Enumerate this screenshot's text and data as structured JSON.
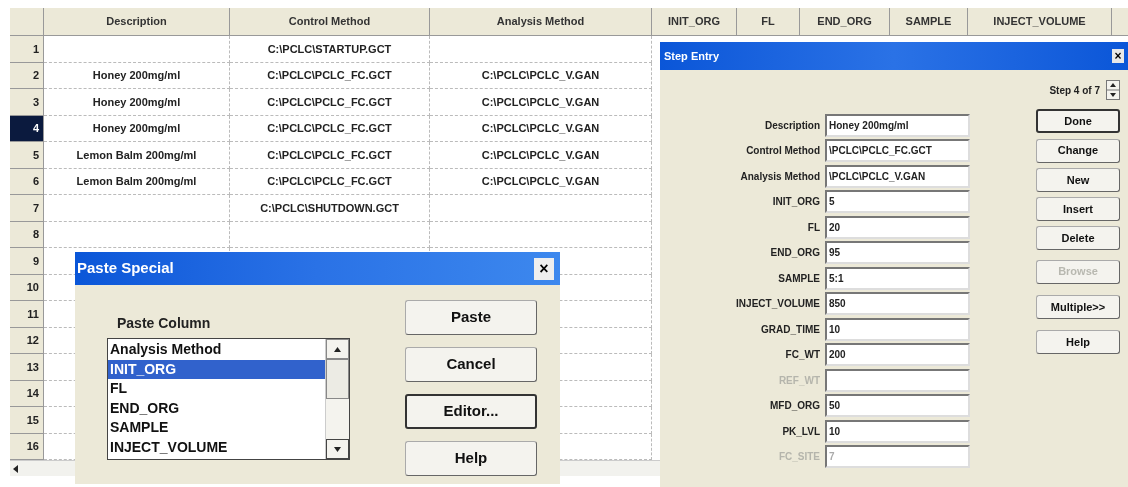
{
  "grid": {
    "columns": [
      "Description",
      "Control Method",
      "Analysis Method",
      "INIT_ORG",
      "FL",
      "END_ORG",
      "SAMPLE",
      "INJECT_VOLUME"
    ],
    "rows": [
      {
        "number": "1",
        "selected": false,
        "control_method": "C:\\PCLC\\STARTUP.GCT"
      },
      {
        "number": "2",
        "selected": false,
        "description": "Honey 200mg/ml",
        "control_method": "C:\\PCLC\\PCLC_FC.GCT",
        "analysis_method": "C:\\PCLC\\PCLC_V.GAN"
      },
      {
        "number": "3",
        "selected": false,
        "description": "Honey 200mg/ml",
        "control_method": "C:\\PCLC\\PCLC_FC.GCT",
        "analysis_method": "C:\\PCLC\\PCLC_V.GAN"
      },
      {
        "number": "4",
        "selected": true,
        "description": "Honey 200mg/ml",
        "control_method": "C:\\PCLC\\PCLC_FC.GCT",
        "analysis_method": "C:\\PCLC\\PCLC_V.GAN"
      },
      {
        "number": "5",
        "selected": false,
        "description": "Lemon Balm 200mg/ml",
        "control_method": "C:\\PCLC\\PCLC_FC.GCT",
        "analysis_method": "C:\\PCLC\\PCLC_V.GAN"
      },
      {
        "number": "6",
        "selected": false,
        "description": "Lemon Balm 200mg/ml",
        "control_method": "C:\\PCLC\\PCLC_FC.GCT",
        "analysis_method": "C:\\PCLC\\PCLC_V.GAN"
      },
      {
        "number": "7",
        "selected": false,
        "control_method": "C:\\PCLC\\SHUTDOWN.GCT"
      },
      {
        "number": "8",
        "selected": false
      },
      {
        "number": "9",
        "selected": false
      },
      {
        "number": "10",
        "selected": false
      },
      {
        "number": "11",
        "selected": false
      },
      {
        "number": "12",
        "selected": false
      },
      {
        "number": "13",
        "selected": false
      },
      {
        "number": "14",
        "selected": false
      },
      {
        "number": "15",
        "selected": false
      },
      {
        "number": "16",
        "selected": false
      }
    ]
  },
  "step_entry": {
    "title": "Step Entry",
    "close": "×",
    "step_label": "Step 4 of 7",
    "fields": [
      {
        "label": "Description",
        "value": "Honey 200mg/ml",
        "disabled": false
      },
      {
        "label": "Control Method",
        "value": "\\PCLC\\PCLC_FC.GCT",
        "disabled": false
      },
      {
        "label": "Analysis Method",
        "value": "\\PCLC\\PCLC_V.GAN",
        "disabled": false
      },
      {
        "label": "INIT_ORG",
        "value": "5",
        "disabled": false
      },
      {
        "label": "FL",
        "value": "20",
        "disabled": false
      },
      {
        "label": "END_ORG",
        "value": "95",
        "disabled": false
      },
      {
        "label": "SAMPLE",
        "value": "5:1",
        "disabled": false
      },
      {
        "label": "INJECT_VOLUME",
        "value": "850",
        "disabled": false
      },
      {
        "label": "GRAD_TIME",
        "value": "10",
        "disabled": false
      },
      {
        "label": "FC_WT",
        "value": "200",
        "disabled": false
      },
      {
        "label": "REF_WT",
        "disabled": true
      },
      {
        "label": "MFD_ORG",
        "value": "50",
        "disabled": false
      },
      {
        "label": "PK_LVL",
        "value": "10",
        "disabled": false
      },
      {
        "label": "FC_SITE",
        "value": "7",
        "disabled": true
      }
    ],
    "buttons": [
      {
        "label": "Done",
        "disabled": false,
        "default": true
      },
      {
        "label": "Change",
        "disabled": false,
        "default": false
      },
      {
        "label": "New",
        "disabled": false,
        "default": false
      },
      {
        "label": "Insert",
        "disabled": false,
        "default": false
      },
      {
        "label": "Delete",
        "disabled": false,
        "default": false
      },
      {
        "label": "Browse",
        "disabled": true,
        "default": false
      },
      {
        "label": "Multiple>>",
        "disabled": false,
        "default": false
      },
      {
        "label": "Help",
        "disabled": false,
        "default": false
      }
    ]
  },
  "paste_special": {
    "title": "Paste Special",
    "close": "×",
    "list_label": "Paste Column",
    "items": [
      {
        "label": "Analysis Method",
        "selected": false
      },
      {
        "label": "INIT_ORG",
        "selected": true
      },
      {
        "label": "FL",
        "selected": false
      },
      {
        "label": "END_ORG",
        "selected": false
      },
      {
        "label": "SAMPLE",
        "selected": false
      },
      {
        "label": "INJECT_VOLUME",
        "selected": false
      }
    ],
    "buttons": [
      {
        "label": "Paste",
        "default": false
      },
      {
        "label": "Cancel",
        "default": false
      },
      {
        "label": "Editor...",
        "default": true
      },
      {
        "label": "Help",
        "default": false
      }
    ]
  }
}
